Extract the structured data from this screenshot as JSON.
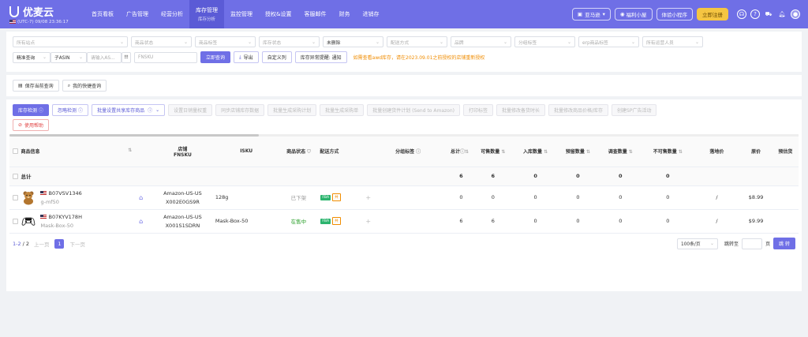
{
  "header": {
    "brand": "优麦云",
    "timezone": "(UTC-7) 09/08 23:36:17",
    "nav": [
      {
        "label": "首页看板"
      },
      {
        "label": "广告管理"
      },
      {
        "label": "经营分析"
      },
      {
        "label": "库存管理",
        "sub": "库存分析",
        "active": true
      },
      {
        "label": "监控管理"
      },
      {
        "label": "授权&设置"
      },
      {
        "label": "客服邮件"
      },
      {
        "label": "财务"
      },
      {
        "label": "进销存"
      }
    ],
    "account": "亚马逊",
    "benefits": "福利小屋",
    "mini_program": "体验小程序",
    "register": "立即注册"
  },
  "filters": {
    "row1": [
      "所有站点",
      "商品状态",
      "商品标签",
      "库存状态",
      "未删除",
      "配送方式",
      "品牌",
      "分组标签",
      "erp商品标签",
      "所有运营人员"
    ],
    "match_mode": "精准查询",
    "sub_type": "子ASIN",
    "keyword_placeholder": "请输入AS...",
    "fnsku_placeholder": "FNSKU",
    "query": "立即查询",
    "export": "导出",
    "custom_columns": "自定义列",
    "alert_notice": "库存异常提醒: 通知",
    "notice": "如需查看awd库存，请在2023.09.01之前授权的店铺重新授权",
    "save_query": "保存当前查询",
    "my_queries": "我的快捷查询"
  },
  "actions": {
    "buttons": [
      {
        "label": "库存检测",
        "style": "primary"
      },
      {
        "label": "忽略检测",
        "style": "outline"
      },
      {
        "label": "批量设置共享库存商品",
        "style": "outline"
      },
      {
        "label": "设置日销量权重",
        "style": "dis"
      },
      {
        "label": "同步店铺库存数据",
        "style": "dis"
      },
      {
        "label": "批量生成采购计划",
        "style": "dis"
      },
      {
        "label": "批量生成采购单",
        "style": "dis"
      },
      {
        "label": "批量创建货件计划 (Send to Amazon)",
        "style": "dis"
      },
      {
        "label": "打印标签",
        "style": "dis"
      },
      {
        "label": "批量修改备货时长",
        "style": "dis"
      },
      {
        "label": "批量修改商品价格/库存",
        "style": "dis"
      },
      {
        "label": "创建SP广告活动",
        "style": "dis"
      }
    ],
    "help": "使用帮助"
  },
  "table": {
    "columns": [
      "商品信息",
      "店铺\nFNSKU",
      "ISKU",
      "商品状态",
      "配送方式",
      "分组标签",
      "总计",
      "可售数量",
      "入库数量",
      "预留数量",
      "调查数量",
      "不可售数量",
      "落地价",
      "原价",
      "预估货"
    ],
    "summary": {
      "label": "总计",
      "total": "6",
      "sellable": "6",
      "inbound": "0",
      "reserved": "0",
      "researching": "0",
      "unsellable": "0"
    },
    "rows": [
      {
        "asin": "B07VSV1346",
        "sku": "g-mf50",
        "shop": "Amazon-US-US",
        "fnsku": "X002E0GS9R",
        "isku": "128g",
        "status": "已下架",
        "status_color": "gray",
        "total": "0",
        "sellable": "0",
        "inbound": "0",
        "reserved": "0",
        "researching": "0",
        "unsellable": "0",
        "landed": "/",
        "price": "$8.99",
        "image": "teddy-bear"
      },
      {
        "asin": "B07KYV178H",
        "sku": "Mask-Box-50",
        "shop": "Amazon-US-US",
        "fnsku": "X001S1SDRN",
        "isku": "Mask-Box-50",
        "status": "在售中",
        "status_color": "green",
        "total": "6",
        "sellable": "6",
        "inbound": "0",
        "reserved": "0",
        "researching": "0",
        "unsellable": "0",
        "landed": "/",
        "price": "$9.99",
        "image": "game-controller"
      }
    ]
  },
  "pager": {
    "range": "1-2",
    "total": "2",
    "prev": "上一页",
    "page": "1",
    "next": "下一页",
    "page_size": "100条/页",
    "jump_label": "跳转至",
    "page_unit": "页",
    "jump_button": "跳 转"
  }
}
